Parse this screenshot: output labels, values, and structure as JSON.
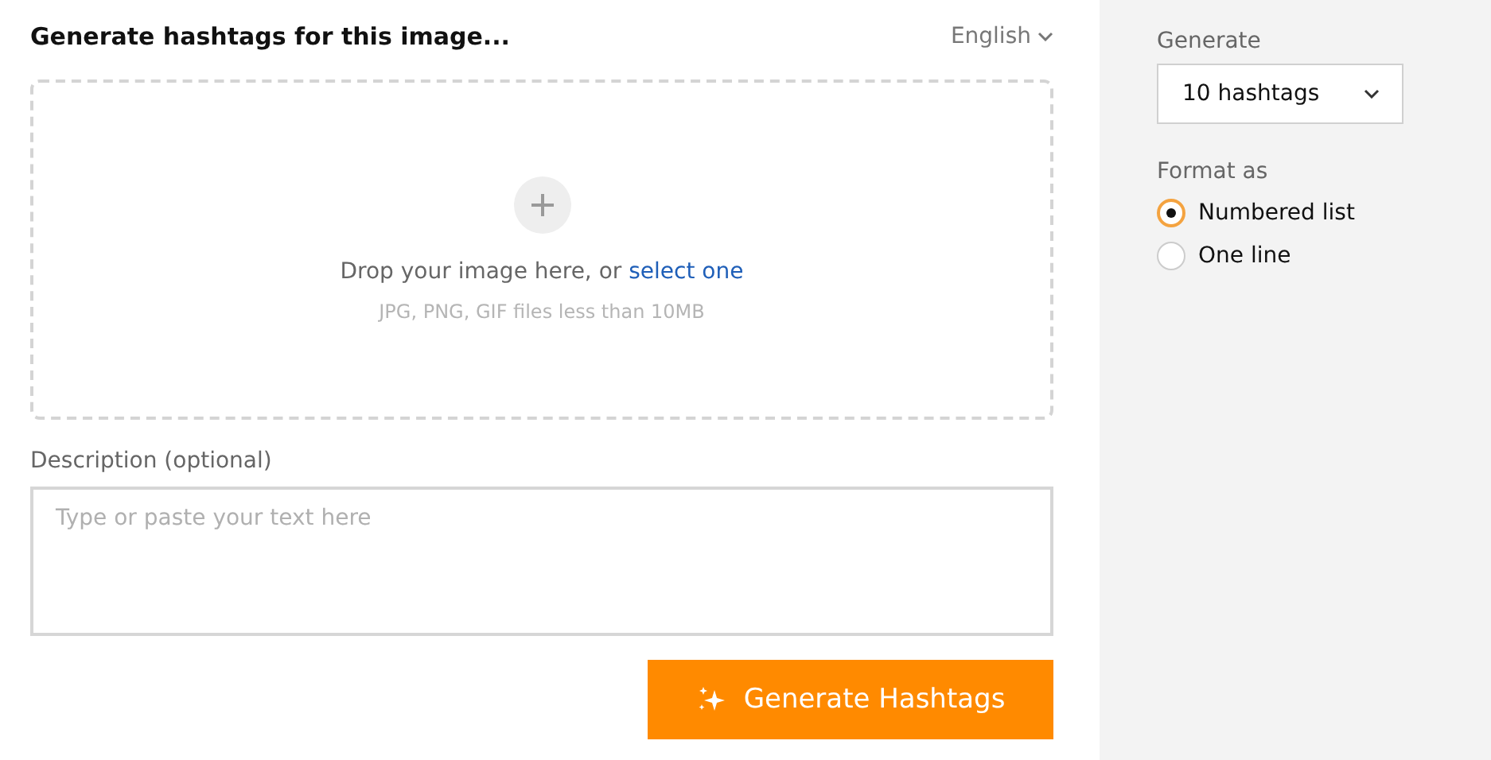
{
  "header": {
    "title": "Generate hashtags for this image...",
    "language": "English"
  },
  "dropzone": {
    "text": "Drop your image here, or ",
    "link": "select one",
    "hint": "JPG, PNG, GIF files less than 10MB"
  },
  "description": {
    "label": "Description (optional)",
    "placeholder": "Type or paste your text here"
  },
  "submit": {
    "label": "Generate Hashtags"
  },
  "sidebar": {
    "generate_label": "Generate",
    "count": "10 hashtags",
    "format_label": "Format as",
    "formats": [
      {
        "label": "Numbered list",
        "selected": true
      },
      {
        "label": "One line",
        "selected": false
      }
    ]
  }
}
